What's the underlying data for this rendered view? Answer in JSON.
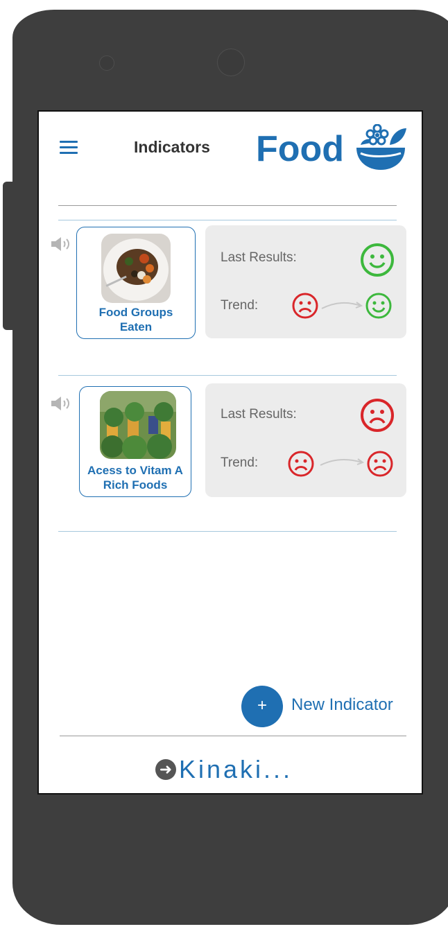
{
  "header": {
    "title": "Indicators",
    "brand": "Food"
  },
  "indicators": [
    {
      "name_line1": "Food Groups",
      "name_line2": "Eaten",
      "last_results_label": "Last Results:",
      "trend_label": "Trend:",
      "last_result": "happy",
      "trend_from": "sad",
      "trend_to": "happy"
    },
    {
      "name_line1": "Acess to Vitam A",
      "name_line2": "Rich Foods",
      "last_results_label": "Last Results:",
      "trend_label": "Trend:",
      "last_result": "sad",
      "trend_from": "sad",
      "trend_to": "sad"
    }
  ],
  "actions": {
    "new_indicator_icon": "+",
    "new_indicator_label": "New Indicator"
  },
  "footer": {
    "link_label": "Kinaki..."
  },
  "colors": {
    "accent": "#1f6fb2",
    "happy": "#3db83d",
    "sad": "#d9262a"
  }
}
